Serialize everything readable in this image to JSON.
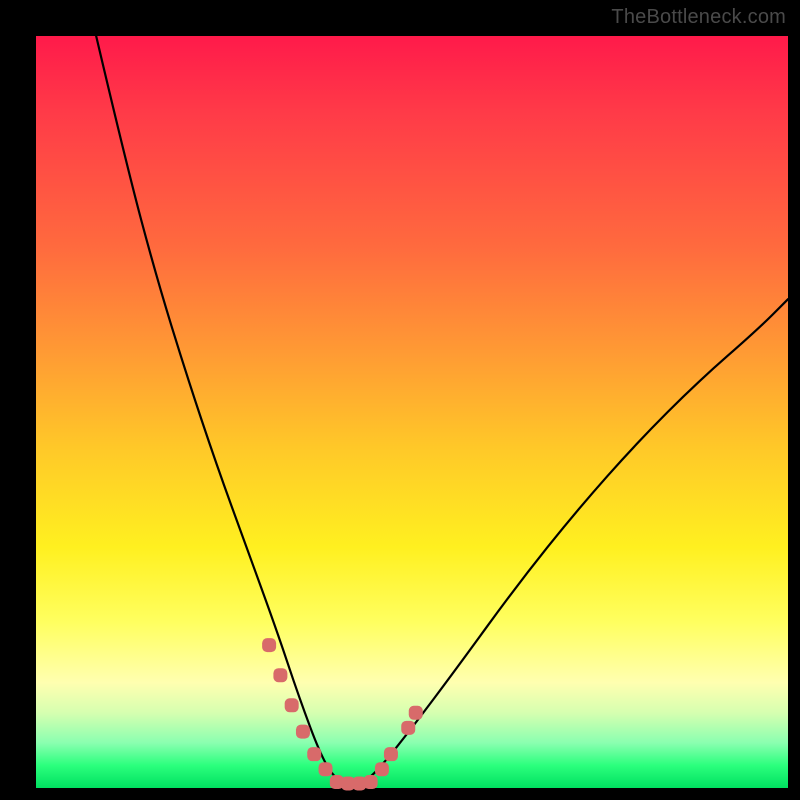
{
  "watermark": {
    "text": "TheBottleneck.com"
  },
  "colors": {
    "frame": "#000000",
    "curve": "#000000",
    "marker": "#d86a6a",
    "gradient_stops": [
      "#ff1a4a",
      "#ff3a48",
      "#ff6a3e",
      "#ff9a34",
      "#ffc928",
      "#fff020",
      "#ffff60",
      "#ffffb0",
      "#d6ffb0",
      "#8affb0",
      "#2bff7d",
      "#00e060"
    ]
  },
  "chart_data": {
    "type": "line",
    "title": "",
    "xlabel": "",
    "ylabel": "",
    "xlim": [
      0,
      100
    ],
    "ylim": [
      0,
      100
    ],
    "grid": false,
    "legend": null,
    "note": "Axes are unitless percentages inferred from a 0–100 screen span; the curve is a V-shaped bottleneck profile with its trough centered near x≈40 reaching y≈0, rising steeply to y≈100 at x≈8 on the left and to y≈65 at x≈100 on the right.",
    "series": [
      {
        "name": "bottleneck-curve",
        "x": [
          8,
          12,
          16,
          20,
          24,
          28,
          32,
          35,
          38,
          40,
          42,
          44,
          46,
          50,
          56,
          64,
          72,
          80,
          88,
          96,
          100
        ],
        "y": [
          100,
          83,
          68,
          55,
          43,
          32,
          21,
          12,
          4,
          1,
          0,
          1,
          3,
          8,
          16,
          27,
          37,
          46,
          54,
          61,
          65
        ]
      }
    ],
    "markers": [
      {
        "name": "left-cluster",
        "shape": "rounded-square",
        "color": "#d86a6a",
        "points": [
          {
            "x": 31.0,
            "y": 19.0
          },
          {
            "x": 32.5,
            "y": 15.0
          },
          {
            "x": 34.0,
            "y": 11.0
          },
          {
            "x": 35.5,
            "y": 7.5
          },
          {
            "x": 37.0,
            "y": 4.5
          },
          {
            "x": 38.5,
            "y": 2.5
          }
        ]
      },
      {
        "name": "trough-cluster",
        "shape": "rounded-square",
        "color": "#d86a6a",
        "points": [
          {
            "x": 40.0,
            "y": 0.8
          },
          {
            "x": 41.5,
            "y": 0.6
          },
          {
            "x": 43.0,
            "y": 0.6
          },
          {
            "x": 44.5,
            "y": 0.8
          }
        ]
      },
      {
        "name": "right-cluster",
        "shape": "rounded-square",
        "color": "#d86a6a",
        "points": [
          {
            "x": 46.0,
            "y": 2.5
          },
          {
            "x": 47.2,
            "y": 4.5
          },
          {
            "x": 49.5,
            "y": 8.0
          },
          {
            "x": 50.5,
            "y": 10.0
          }
        ]
      }
    ]
  }
}
